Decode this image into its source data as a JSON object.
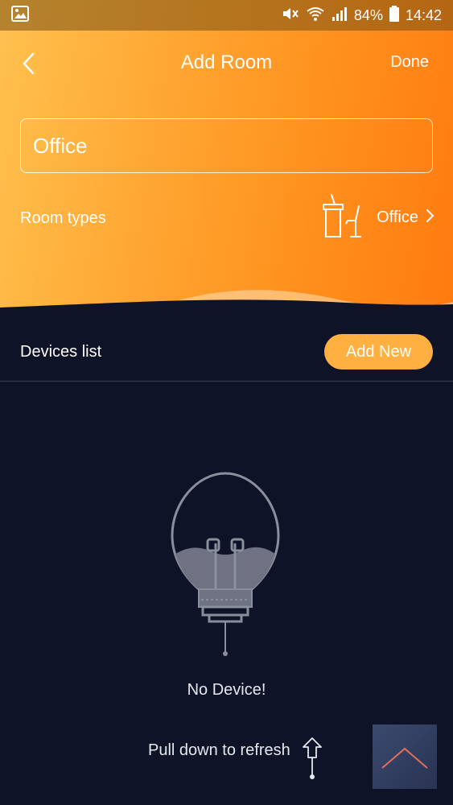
{
  "status_bar": {
    "battery": "84%",
    "time": "14:42"
  },
  "header": {
    "title": "Add Room",
    "done_label": "Done"
  },
  "room_name": {
    "value": "Office"
  },
  "room_types": {
    "label": "Room types",
    "selected": "Office"
  },
  "devices": {
    "label": "Devices list",
    "add_new_label": "Add New"
  },
  "empty_state": {
    "message": "No Device!",
    "pull_hint": "Pull down to refresh"
  },
  "colors": {
    "accent": "#ffb040",
    "background": "#0e1327",
    "gradient_start": "#ffc14f",
    "gradient_end": "#ff7a10"
  }
}
